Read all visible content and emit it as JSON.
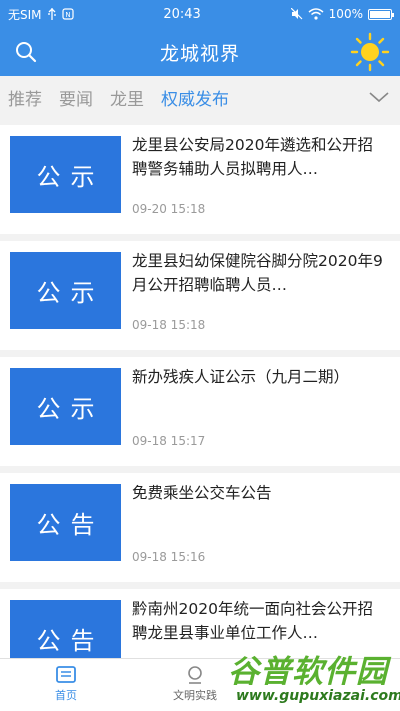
{
  "status": {
    "carrier": "无SIM",
    "time": "20:43",
    "battery": "100%"
  },
  "header": {
    "title": "龙城视界"
  },
  "tabs": [
    {
      "label": "推荐",
      "active": false
    },
    {
      "label": "要闻",
      "active": false
    },
    {
      "label": "龙里",
      "active": false
    },
    {
      "label": "权威发布",
      "active": true
    }
  ],
  "news": [
    {
      "thumb": "公示",
      "title": " 龙里县公安局2020年遴选和公开招聘警务辅助人员拟聘用人…",
      "time": "09-20 15:18"
    },
    {
      "thumb": "公示",
      "title": "龙里县妇幼保健院谷脚分院2020年9月公开招聘临聘人员…",
      "time": "09-18 15:18"
    },
    {
      "thumb": "公示",
      "title": "新办残疾人证公示（九月二期）",
      "time": "09-18 15:17"
    },
    {
      "thumb": "公告",
      "title": "免费乘坐公交车公告",
      "time": "09-18 15:16"
    },
    {
      "thumb": "公告",
      "title": "黔南州2020年统一面向社会公开招聘龙里县事业单位工作人…",
      "time": ""
    }
  ],
  "bottom_nav": [
    {
      "label": "首页",
      "icon": "home-icon"
    },
    {
      "label": "文明实践",
      "icon": "culture-icon"
    }
  ],
  "watermark": {
    "main": "谷普软件园",
    "url": "www.gupuxiazai.com"
  },
  "colors": {
    "primary": "#3a8ee6",
    "thumb": "#2b76dd",
    "watermark": "#5ab130"
  }
}
